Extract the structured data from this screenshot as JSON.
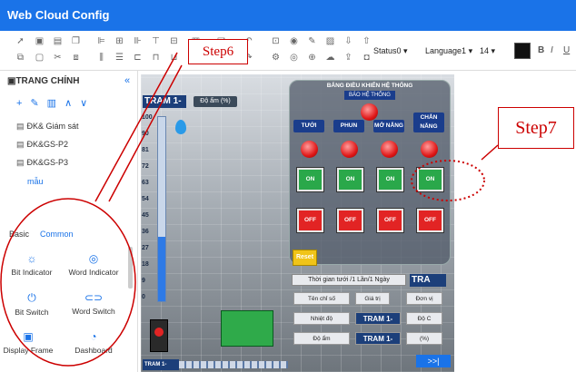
{
  "app": {
    "title": "Web Cloud Config"
  },
  "toolbar": {
    "status_select": "Status0",
    "language_select": "Language1",
    "font_size": "14",
    "color": "#111111",
    "format_bold": "B",
    "format_italic": "I",
    "format_underline": "U"
  },
  "sidebar": {
    "title": "TRANG CHÍNH",
    "pages": [
      "ĐK& Giám sát",
      "ĐK&GS-P2",
      "ĐK&GS-P3",
      "mẫu"
    ],
    "tabs": [
      "Basic",
      "Common"
    ],
    "components": [
      "Bit Indicator",
      "Word Indicator",
      "Bit Switch",
      "Word Switch",
      "Display Frame",
      "Dashboard"
    ]
  },
  "canvas": {
    "tram_title": "TRAM 1-",
    "humidity_label": "Độ ẩm (%)",
    "gauge_ticks": [
      "100",
      "90",
      "81",
      "72",
      "63",
      "54",
      "45",
      "36",
      "27",
      "18",
      "9",
      "0"
    ],
    "gauge_level": 0.35,
    "panel": {
      "title": "BẢNG ĐIỀU KHIỂN HỆ THỐNG",
      "alarm_label": "BÁO HỆ THỐNG",
      "channels": [
        {
          "name": "TƯỚI",
          "on": "ON",
          "off": "OFF"
        },
        {
          "name": "PHUN",
          "on": "ON",
          "off": "OFF"
        },
        {
          "name": "MỞ NẮNG",
          "on": "ON",
          "off": "OFF"
        },
        {
          "name": "CHẮN NẮNG",
          "on": "ON",
          "off": "OFF"
        }
      ],
      "reset": "Reset"
    },
    "schedule": "Thời gian tưới /1 Lần/1 Ngày",
    "tra_label": "TRA",
    "table": {
      "headers": [
        "Tên chỉ số",
        "Giá trị",
        "Đơn vị"
      ],
      "rows": [
        {
          "name": "Nhiệt độ",
          "value": "TRAM 1-",
          "unit": "Độ C"
        },
        {
          "name": "Độ ẩm",
          "value": "TRAM 1-",
          "unit": "(%)"
        }
      ]
    },
    "bottom_tram": "TRAM 1-",
    "nav_button": ">>|"
  },
  "annotations": {
    "step6": "Step6",
    "step7": "Step7"
  },
  "colors": {
    "accent": "#1a73e8",
    "annotation": "#cc0000"
  }
}
